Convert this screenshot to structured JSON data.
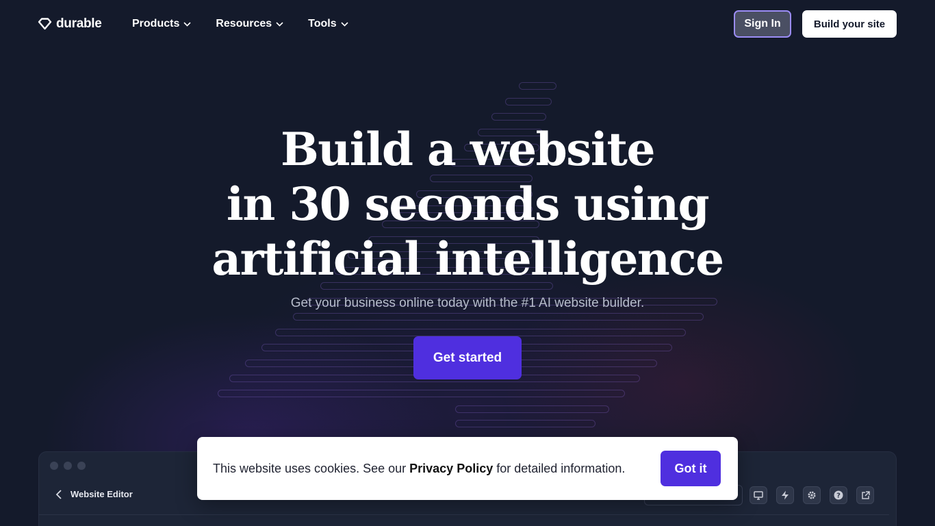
{
  "brand": {
    "name": "durable"
  },
  "nav": {
    "items": [
      {
        "label": "Products",
        "icon": "chevron-down-icon"
      },
      {
        "label": "Resources",
        "icon": "chevron-down-icon"
      },
      {
        "label": "Tools",
        "icon": "chevron-down-icon"
      }
    ],
    "sign_in": "Sign In",
    "build_site": "Build your site"
  },
  "hero": {
    "title_lines": [
      "Build a website",
      "in 30 seconds using",
      "artificial intelligence"
    ],
    "subtitle": "Get your business online today with the #1 AI website builder.",
    "cta": "Get started"
  },
  "editor_preview": {
    "title": "Website Editor",
    "toolbar_icons": [
      "desktop-icon",
      "lightning-icon",
      "gear-icon",
      "help-icon",
      "external-link-icon"
    ]
  },
  "cookie": {
    "text_before": "This website uses cookies. See our ",
    "link": "Privacy Policy",
    "text_after": " for detailed information.",
    "button": "Got it"
  },
  "colors": {
    "background": "#141a2b",
    "accent": "#4f2fdf",
    "signin_border": "#9b8cf5"
  }
}
